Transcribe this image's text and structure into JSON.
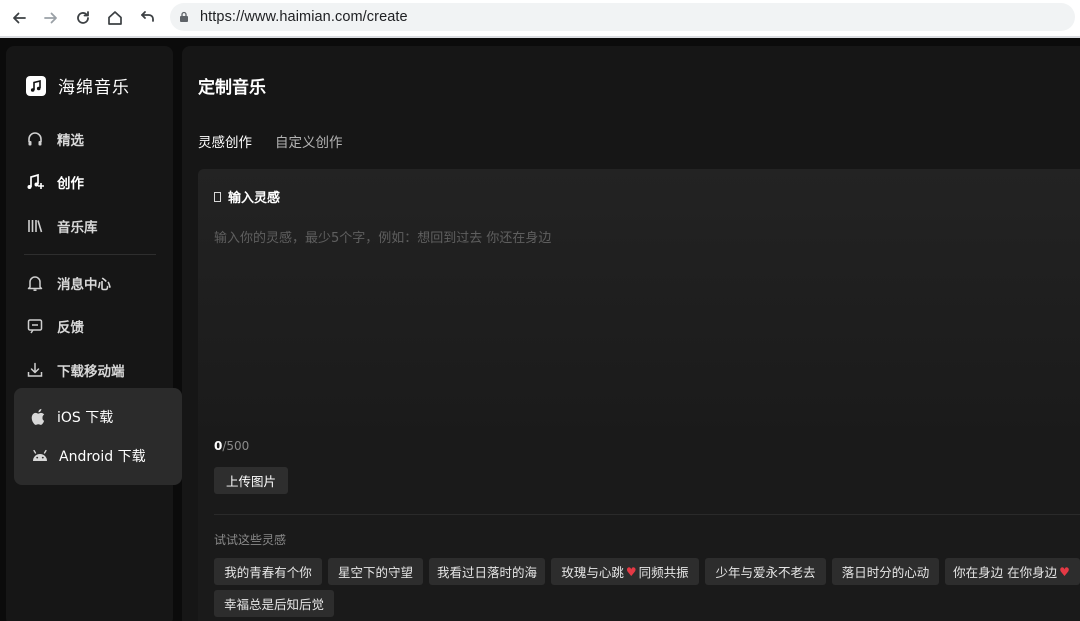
{
  "browser": {
    "url": "https://www.haimian.com/create"
  },
  "sidebar": {
    "brand": "海绵音乐",
    "items": [
      {
        "label": "精选"
      },
      {
        "label": "创作"
      },
      {
        "label": "音乐库"
      },
      {
        "label": "消息中心"
      },
      {
        "label": "反馈"
      },
      {
        "label": "下载移动端"
      }
    ],
    "download": {
      "ios": "iOS 下载",
      "android": "Android 下载"
    }
  },
  "main": {
    "title": "定制音乐",
    "tabs": [
      {
        "label": "灵感创作"
      },
      {
        "label": "自定义创作"
      }
    ],
    "input": {
      "label": "输入灵感",
      "placeholder": "输入你的灵感，最少5个字，例如：想回到过去 你还在身边",
      "count_current": "0",
      "count_max": "/500",
      "upload_label": "上传图片"
    },
    "ideas": {
      "title": "试试这些灵感",
      "chips": [
        {
          "text": "我的青春有个你"
        },
        {
          "text": "星空下的守望"
        },
        {
          "text": "我看过日落时的海"
        },
        {
          "text": "玫瑰与心跳",
          "suffix": "同频共振"
        },
        {
          "text": "少年与爱永不老去"
        },
        {
          "text": "落日时分的心动"
        },
        {
          "text": "你在身边 在你身边"
        },
        {
          "text": "幸福总是后知后觉"
        }
      ]
    }
  },
  "colors": {
    "accent_heart": "#e53945",
    "background": "#0b0b0b",
    "panel": "#161616"
  }
}
